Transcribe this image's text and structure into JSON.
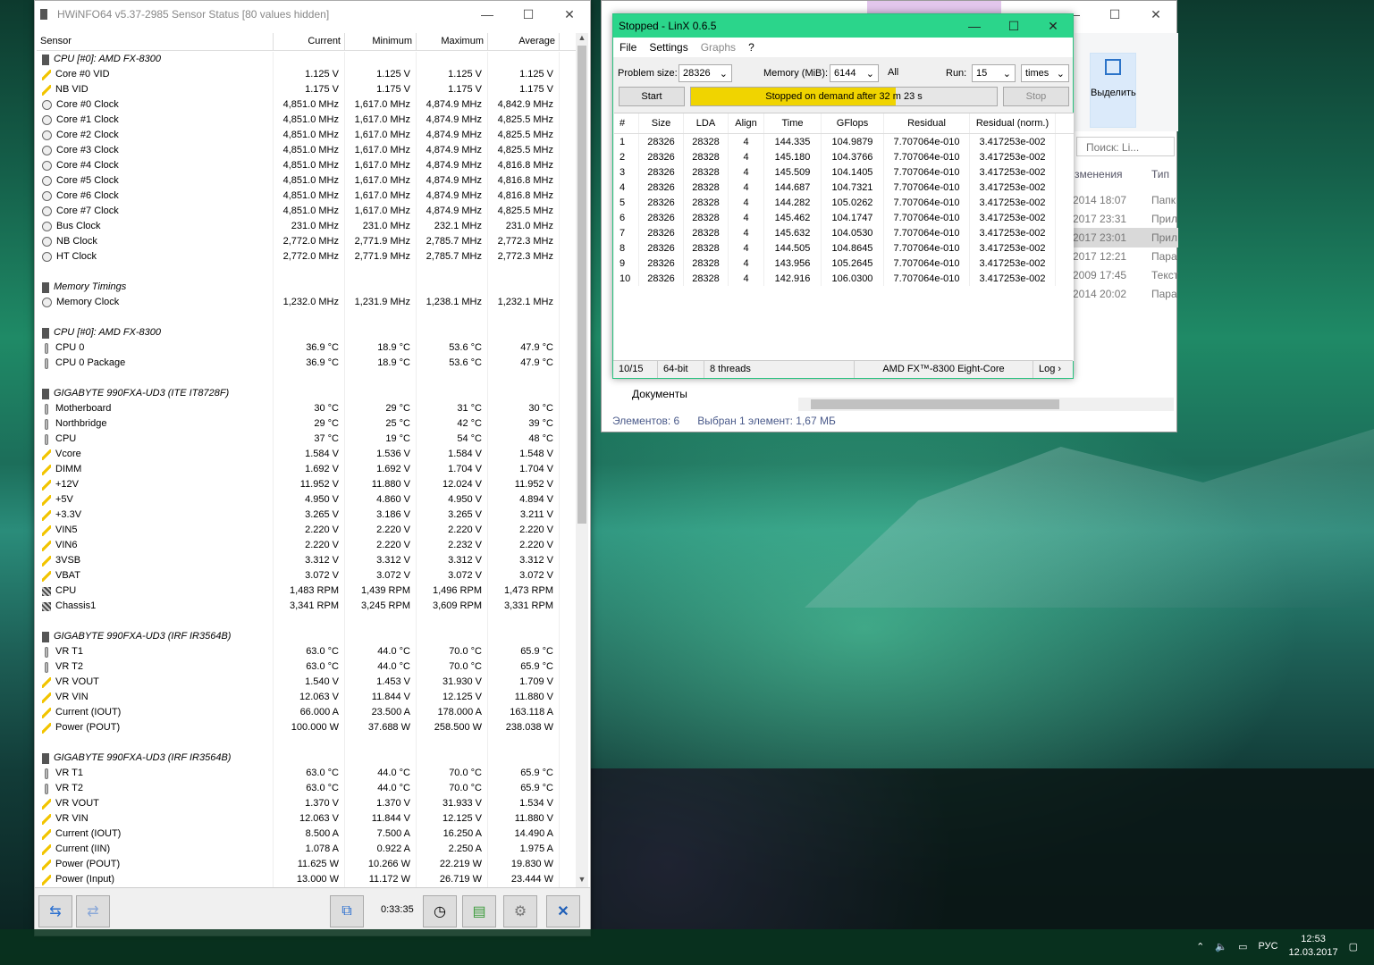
{
  "hwinfo": {
    "title": "HWiNFO64 v5.37-2985 Sensor Status [80 values hidden]",
    "columns": [
      "Sensor",
      "Current",
      "Minimum",
      "Maximum",
      "Average"
    ],
    "timer": "0:33:35",
    "rows": [
      {
        "t": "group",
        "icon": "chip",
        "name": "CPU [#0]: AMD FX-8300"
      },
      {
        "icon": "volt",
        "name": "Core #0 VID",
        "v": [
          "1.125 V",
          "1.125 V",
          "1.125 V",
          "1.125 V"
        ]
      },
      {
        "icon": "volt",
        "name": "NB VID",
        "v": [
          "1.175 V",
          "1.175 V",
          "1.175 V",
          "1.175 V"
        ]
      },
      {
        "icon": "clock",
        "name": "Core #0 Clock",
        "v": [
          "4,851.0 MHz",
          "1,617.0 MHz",
          "4,874.9 MHz",
          "4,842.9 MHz"
        ]
      },
      {
        "icon": "clock",
        "name": "Core #1 Clock",
        "v": [
          "4,851.0 MHz",
          "1,617.0 MHz",
          "4,874.9 MHz",
          "4,825.5 MHz"
        ]
      },
      {
        "icon": "clock",
        "name": "Core #2 Clock",
        "v": [
          "4,851.0 MHz",
          "1,617.0 MHz",
          "4,874.9 MHz",
          "4,825.5 MHz"
        ]
      },
      {
        "icon": "clock",
        "name": "Core #3 Clock",
        "v": [
          "4,851.0 MHz",
          "1,617.0 MHz",
          "4,874.9 MHz",
          "4,825.5 MHz"
        ]
      },
      {
        "icon": "clock",
        "name": "Core #4 Clock",
        "v": [
          "4,851.0 MHz",
          "1,617.0 MHz",
          "4,874.9 MHz",
          "4,816.8 MHz"
        ]
      },
      {
        "icon": "clock",
        "name": "Core #5 Clock",
        "v": [
          "4,851.0 MHz",
          "1,617.0 MHz",
          "4,874.9 MHz",
          "4,816.8 MHz"
        ]
      },
      {
        "icon": "clock",
        "name": "Core #6 Clock",
        "v": [
          "4,851.0 MHz",
          "1,617.0 MHz",
          "4,874.9 MHz",
          "4,816.8 MHz"
        ]
      },
      {
        "icon": "clock",
        "name": "Core #7 Clock",
        "v": [
          "4,851.0 MHz",
          "1,617.0 MHz",
          "4,874.9 MHz",
          "4,825.5 MHz"
        ]
      },
      {
        "icon": "clock",
        "name": "Bus Clock",
        "v": [
          "231.0 MHz",
          "231.0 MHz",
          "232.1 MHz",
          "231.0 MHz"
        ]
      },
      {
        "icon": "clock",
        "name": "NB Clock",
        "v": [
          "2,772.0 MHz",
          "2,771.9 MHz",
          "2,785.7 MHz",
          "2,772.3 MHz"
        ]
      },
      {
        "icon": "clock",
        "name": "HT Clock",
        "v": [
          "2,772.0 MHz",
          "2,771.9 MHz",
          "2,785.7 MHz",
          "2,772.3 MHz"
        ]
      },
      {
        "t": "blank"
      },
      {
        "t": "group",
        "icon": "chip",
        "name": "Memory Timings"
      },
      {
        "icon": "clock",
        "name": "Memory Clock",
        "v": [
          "1,232.0 MHz",
          "1,231.9 MHz",
          "1,238.1 MHz",
          "1,232.1 MHz"
        ]
      },
      {
        "t": "blank"
      },
      {
        "t": "group",
        "icon": "chip",
        "name": "CPU [#0]: AMD FX-8300"
      },
      {
        "icon": "temp",
        "name": "CPU 0",
        "v": [
          "36.9 °C",
          "18.9 °C",
          "53.6 °C",
          "47.9 °C"
        ]
      },
      {
        "icon": "temp",
        "name": "CPU 0 Package",
        "v": [
          "36.9 °C",
          "18.9 °C",
          "53.6 °C",
          "47.9 °C"
        ]
      },
      {
        "t": "blank"
      },
      {
        "t": "group",
        "icon": "chip",
        "name": "GIGABYTE 990FXA-UD3 (ITE IT8728F)"
      },
      {
        "icon": "temp",
        "name": "Motherboard",
        "v": [
          "30 °C",
          "29 °C",
          "31 °C",
          "30 °C"
        ]
      },
      {
        "icon": "temp",
        "name": "Northbridge",
        "v": [
          "29 °C",
          "25 °C",
          "42 °C",
          "39 °C"
        ]
      },
      {
        "icon": "temp",
        "name": "CPU",
        "v": [
          "37 °C",
          "19 °C",
          "54 °C",
          "48 °C"
        ]
      },
      {
        "icon": "volt",
        "name": "Vcore",
        "v": [
          "1.584 V",
          "1.536 V",
          "1.584 V",
          "1.548 V"
        ]
      },
      {
        "icon": "volt",
        "name": "DIMM",
        "v": [
          "1.692 V",
          "1.692 V",
          "1.704 V",
          "1.704 V"
        ]
      },
      {
        "icon": "volt",
        "name": "+12V",
        "v": [
          "11.952 V",
          "11.880 V",
          "12.024 V",
          "11.952 V"
        ]
      },
      {
        "icon": "volt",
        "name": "+5V",
        "v": [
          "4.950 V",
          "4.860 V",
          "4.950 V",
          "4.894 V"
        ]
      },
      {
        "icon": "volt",
        "name": "+3.3V",
        "v": [
          "3.265 V",
          "3.186 V",
          "3.265 V",
          "3.211 V"
        ]
      },
      {
        "icon": "volt",
        "name": "VIN5",
        "v": [
          "2.220 V",
          "2.220 V",
          "2.220 V",
          "2.220 V"
        ]
      },
      {
        "icon": "volt",
        "name": "VIN6",
        "v": [
          "2.220 V",
          "2.220 V",
          "2.232 V",
          "2.220 V"
        ]
      },
      {
        "icon": "volt",
        "name": "3VSB",
        "v": [
          "3.312 V",
          "3.312 V",
          "3.312 V",
          "3.312 V"
        ]
      },
      {
        "icon": "volt",
        "name": "VBAT",
        "v": [
          "3.072 V",
          "3.072 V",
          "3.072 V",
          "3.072 V"
        ]
      },
      {
        "icon": "fan",
        "name": "CPU",
        "v": [
          "1,483 RPM",
          "1,439 RPM",
          "1,496 RPM",
          "1,473 RPM"
        ]
      },
      {
        "icon": "fan",
        "name": "Chassis1",
        "v": [
          "3,341 RPM",
          "3,245 RPM",
          "3,609 RPM",
          "3,331 RPM"
        ]
      },
      {
        "t": "blank"
      },
      {
        "t": "group",
        "icon": "chip",
        "name": "GIGABYTE 990FXA-UD3 (IRF IR3564B)"
      },
      {
        "icon": "temp",
        "name": "VR T1",
        "v": [
          "63.0 °C",
          "44.0 °C",
          "70.0 °C",
          "65.9 °C"
        ]
      },
      {
        "icon": "temp",
        "name": "VR T2",
        "v": [
          "63.0 °C",
          "44.0 °C",
          "70.0 °C",
          "65.9 °C"
        ]
      },
      {
        "icon": "volt",
        "name": "VR VOUT",
        "v": [
          "1.540 V",
          "1.453 V",
          "31.930 V",
          "1.709 V"
        ]
      },
      {
        "icon": "volt",
        "name": "VR VIN",
        "v": [
          "12.063 V",
          "11.844 V",
          "12.125 V",
          "11.880 V"
        ]
      },
      {
        "icon": "volt",
        "name": "Current (IOUT)",
        "v": [
          "66.000 A",
          "23.500 A",
          "178.000 A",
          "163.118 A"
        ]
      },
      {
        "icon": "volt",
        "name": "Power (POUT)",
        "v": [
          "100.000 W",
          "37.688 W",
          "258.500 W",
          "238.038 W"
        ]
      },
      {
        "t": "blank"
      },
      {
        "t": "group",
        "icon": "chip",
        "name": "GIGABYTE 990FXA-UD3 (IRF IR3564B)"
      },
      {
        "icon": "temp",
        "name": "VR T1",
        "v": [
          "63.0 °C",
          "44.0 °C",
          "70.0 °C",
          "65.9 °C"
        ]
      },
      {
        "icon": "temp",
        "name": "VR T2",
        "v": [
          "63.0 °C",
          "44.0 °C",
          "70.0 °C",
          "65.9 °C"
        ]
      },
      {
        "icon": "volt",
        "name": "VR VOUT",
        "v": [
          "1.370 V",
          "1.370 V",
          "31.933 V",
          "1.534 V"
        ]
      },
      {
        "icon": "volt",
        "name": "VR VIN",
        "v": [
          "12.063 V",
          "11.844 V",
          "12.125 V",
          "11.880 V"
        ]
      },
      {
        "icon": "volt",
        "name": "Current (IOUT)",
        "v": [
          "8.500 A",
          "7.500 A",
          "16.250 A",
          "14.490 A"
        ]
      },
      {
        "icon": "volt",
        "name": "Current (IIN)",
        "v": [
          "1.078 A",
          "0.922 A",
          "2.250 A",
          "1.975 A"
        ]
      },
      {
        "icon": "volt",
        "name": "Power (POUT)",
        "v": [
          "11.625 W",
          "10.266 W",
          "22.219 W",
          "19.830 W"
        ]
      },
      {
        "icon": "volt",
        "name": "Power (Input)",
        "v": [
          "13.000 W",
          "11.172 W",
          "26.719 W",
          "23.444 W"
        ]
      }
    ]
  },
  "linx": {
    "title": "Stopped - LinX 0.6.5",
    "menu": [
      "File",
      "Settings",
      "Graphs",
      "?"
    ],
    "problem_label": "Problem size:",
    "problem_value": "28326",
    "memory_label": "Memory (MiB):",
    "memory_value": "6144",
    "all_label": "All",
    "run_label": "Run:",
    "run_value": "15",
    "times_value": "times",
    "start_label": "Start",
    "stop_label": "Stop",
    "progress_text": "Stopped on demand after 32 m 23 s",
    "progress_fraction": 0.67,
    "columns": [
      "#",
      "Size",
      "LDA",
      "Align",
      "Time",
      "GFlops",
      "Residual",
      "Residual (norm.)"
    ],
    "rows": [
      [
        "1",
        "28326",
        "28328",
        "4",
        "144.335",
        "104.9879",
        "7.707064e-010",
        "3.417253e-002"
      ],
      [
        "2",
        "28326",
        "28328",
        "4",
        "145.180",
        "104.3766",
        "7.707064e-010",
        "3.417253e-002"
      ],
      [
        "3",
        "28326",
        "28328",
        "4",
        "145.509",
        "104.1405",
        "7.707064e-010",
        "3.417253e-002"
      ],
      [
        "4",
        "28326",
        "28328",
        "4",
        "144.687",
        "104.7321",
        "7.707064e-010",
        "3.417253e-002"
      ],
      [
        "5",
        "28326",
        "28328",
        "4",
        "144.282",
        "105.0262",
        "7.707064e-010",
        "3.417253e-002"
      ],
      [
        "6",
        "28326",
        "28328",
        "4",
        "145.462",
        "104.1747",
        "7.707064e-010",
        "3.417253e-002"
      ],
      [
        "7",
        "28326",
        "28328",
        "4",
        "145.632",
        "104.0530",
        "7.707064e-010",
        "3.417253e-002"
      ],
      [
        "8",
        "28326",
        "28328",
        "4",
        "144.505",
        "104.8645",
        "7.707064e-010",
        "3.417253e-002"
      ],
      [
        "9",
        "28326",
        "28328",
        "4",
        "143.956",
        "105.2645",
        "7.707064e-010",
        "3.417253e-002"
      ],
      [
        "10",
        "28326",
        "28328",
        "4",
        "142.916",
        "106.0300",
        "7.707064e-010",
        "3.417253e-002"
      ]
    ],
    "status": [
      "10/15",
      "64-bit",
      "8 threads",
      "AMD FX™-8300 Eight-Core",
      "Log ›"
    ]
  },
  "explorer": {
    "select_label": "Выделить",
    "search_placeholder": "Поиск: Li...",
    "col_date": "зменения",
    "col_type": "Тип",
    "dates": [
      "2014 18:07",
      "2017 23:31",
      "2017 23:01",
      "2017 12:21",
      "2009 17:45",
      "2014 20:02"
    ],
    "types": [
      "Папк",
      "Прил",
      "Прил",
      "Пара",
      "Текст",
      "Пара"
    ],
    "docs_label": "Документы",
    "status_items": "Элементов: 6",
    "status_selected": "Выбран 1 элемент: 1,67 МБ"
  },
  "taskbar": {
    "lang": "РУС",
    "time": "12:53",
    "date": "12.03.2017"
  }
}
